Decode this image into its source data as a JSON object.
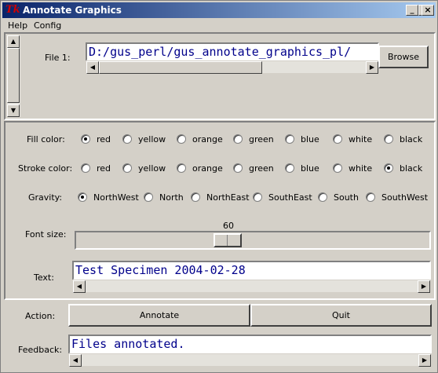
{
  "window": {
    "title": "Annotate Graphics",
    "icon": "tk-feather-icon"
  },
  "titlebar_buttons": {
    "minimize": "_",
    "maximize": "□",
    "close": "×"
  },
  "menu": {
    "help": "Help",
    "config": "Config"
  },
  "file": {
    "label": "File 1:",
    "value": "D:/gus_perl/gus_annotate_graphics_pl/",
    "browse_label": "Browse"
  },
  "fill": {
    "label": "Fill color:",
    "options": [
      "red",
      "yellow",
      "orange",
      "green",
      "blue",
      "white",
      "black"
    ],
    "selected": "red"
  },
  "stroke": {
    "label": "Stroke color:",
    "options": [
      "red",
      "yellow",
      "orange",
      "green",
      "blue",
      "white",
      "black"
    ],
    "selected": "black"
  },
  "gravity": {
    "label": "Gravity:",
    "options": [
      "NorthWest",
      "North",
      "NorthEast",
      "SouthEast",
      "South",
      "SouthWest"
    ],
    "selected": "NorthWest"
  },
  "font_size": {
    "label": "Font size:",
    "value": "60"
  },
  "text": {
    "label": "Text:",
    "value": "Test Specimen 2004-02-28"
  },
  "action": {
    "label": "Action:",
    "annotate_label": "Annotate",
    "quit_label": "Quit"
  },
  "feedback": {
    "label": "Feedback:",
    "value": "Files annotated."
  }
}
